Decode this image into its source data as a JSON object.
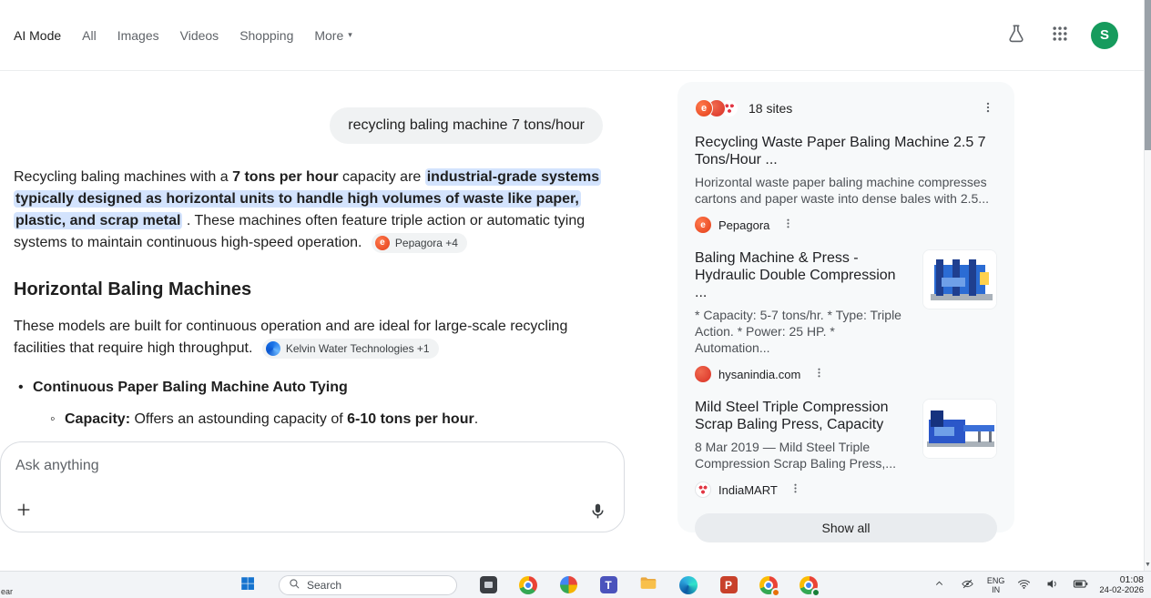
{
  "colors": {
    "highlight": "#d3e3fd",
    "avatar_green": "#169b5d",
    "card_background": "#f7f9fa",
    "chip_background": "#f1f3f4",
    "accent_blue": "#4285f4"
  },
  "icons": {
    "labs": "flask-icon",
    "apps": "grid-icon",
    "overflow": "three-dot-menu-icon",
    "mic": "microphone-icon",
    "plus": "plus-icon",
    "more_arrow": "▾",
    "scroll_down_arrow": "▼",
    "pepagora_letter": "e",
    "powerpoint_letter": "P",
    "teams_letter": "T"
  },
  "topbar": {
    "tabs": [
      "AI Mode",
      "All",
      "Images",
      "Videos",
      "Shopping",
      "More"
    ],
    "avatar_letter": "S"
  },
  "query": "recycling baling machine 7 tons/hour",
  "answer": {
    "s1": "Recycling baling machines with a ",
    "s2": "7 tons per hour",
    "s3": " capacity are ",
    "s4": "industrial-grade systems typically designed as horizontal units to handle high volumes of waste like paper, plastic, and scrap metal",
    "s5": " . These machines often feature triple action or automatic tying systems to maintain continuous high-speed operation.",
    "citation1": "Pepagora +4",
    "heading": "Horizontal Baling Machines",
    "p2": "These models are built for continuous operation and are ideal for large-scale recycling facilities that require high throughput. ",
    "citation2": "Kelvin Water Technologies +1",
    "bullet_title": "Continuous Paper Baling Machine Auto Tying",
    "capacity_label": "Capacity:",
    "capacity_t1": " Offers an astounding capacity of ",
    "capacity_bold": "6-10 tons per hour",
    "capacity_t2": "."
  },
  "ask": {
    "placeholder": "Ask anything"
  },
  "sites_panel": {
    "count": "18 sites",
    "results": [
      {
        "title": "Recycling Waste Paper Baling Machine 2.5 7 Tons/Hour ...",
        "desc": "Horizontal waste paper baling machine compresses cartons and paper waste into dense bales with 2.5...",
        "source": "Pepagora"
      },
      {
        "title": "Baling Machine & Press - Hydraulic Double Compression ...",
        "desc": "* Capacity: 5-7 tons/hr. * Type: Triple Action. * Power: 25 HP. * Automation...",
        "source": "hysanindia.com"
      },
      {
        "title": "Mild Steel Triple Compression Scrap Baling Press, Capacity",
        "desc": "8 Mar 2019 — Mild Steel Triple Compression Scrap Baling Press,...",
        "source": "IndiaMART"
      }
    ],
    "show_all": "Show all"
  },
  "taskbar": {
    "search_placeholder": "Search",
    "partial_text": "ear",
    "tray": {
      "lang": "ENG",
      "region": "IN",
      "time": "01:08",
      "date": "24-02-2026"
    }
  }
}
